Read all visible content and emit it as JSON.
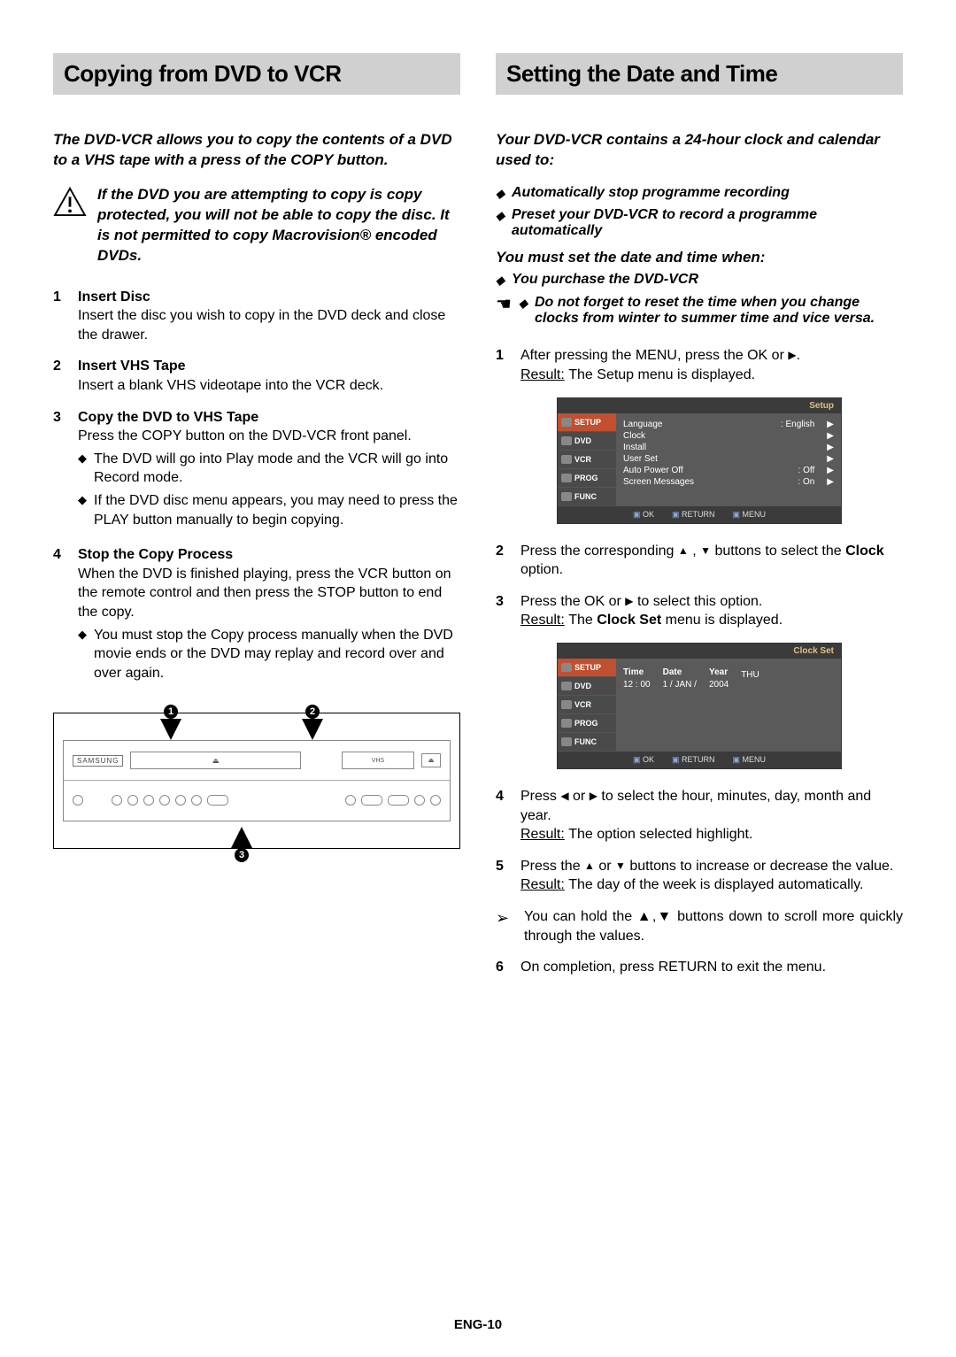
{
  "left": {
    "header": "Copying from DVD to VCR",
    "intro": "The DVD-VCR allows you to copy the contents of a DVD to a VHS tape with a press of the COPY button.",
    "warning": "If the DVD you are attempting to copy is copy protected, you will not be able to copy the disc. It is not permitted to copy Macrovision® encoded DVDs.",
    "steps": [
      {
        "num": "1",
        "title": "Insert Disc",
        "body": "Insert the disc you wish to copy in the DVD deck and close the drawer."
      },
      {
        "num": "2",
        "title": "Insert VHS Tape",
        "body": "Insert a blank VHS videotape into the VCR deck."
      },
      {
        "num": "3",
        "title": "Copy the DVD to VHS Tape",
        "body": "Press the COPY button on the DVD-VCR front panel.",
        "bullets": [
          "The DVD will go into Play mode and the VCR will go into Record mode.",
          "If the DVD disc menu appears, you may need to press the PLAY button manually to begin copying."
        ]
      },
      {
        "num": "4",
        "title": "Stop the Copy Process",
        "body": "When the DVD is finished playing, press the VCR button on the remote control and then press the STOP button to end the copy.",
        "bullets": [
          "You must stop the Copy process manually when the DVD movie ends or the DVD may replay and record over and over again."
        ]
      }
    ],
    "diagram": {
      "brand": "SAMSUNG",
      "vhs": "VHS",
      "markers": [
        "1",
        "2",
        "3"
      ]
    }
  },
  "right": {
    "header": "Setting the Date and Time",
    "intro": "Your DVD-VCR contains a 24-hour clock and calendar used to:",
    "intro_bullets": [
      "Automatically stop programme recording",
      "Preset your DVD-VCR to record a programme automatically"
    ],
    "must_set": "You must set the date and time when:",
    "must_set_bullets": [
      "You purchase the DVD-VCR"
    ],
    "pointer_note": "Do not forget to reset the time when you change clocks from winter to summer time and vice versa.",
    "steps": [
      {
        "num": "1",
        "body_pre": "After pressing the MENU, press the OK or ",
        "body_post": ".",
        "result": "The Setup menu is displayed."
      },
      {
        "num": "2",
        "body_pre": "Press the corresponding ",
        "body_mid": " , ",
        "body_post": " buttons to select the ",
        "bold": "Clock",
        "body_end": " option."
      },
      {
        "num": "3",
        "body_pre": "Press the OK or ",
        "body_post": " to select this option.",
        "result_pre": "The ",
        "result_bold": "Clock Set",
        "result_post": " menu is displayed."
      },
      {
        "num": "4",
        "body_pre": "Press ",
        "body_mid": " or ",
        "body_post": " to select the hour, minutes, day, month and year.",
        "result": "The option selected highlight."
      },
      {
        "num": "5",
        "body_pre": "Press the ",
        "body_mid": " or ",
        "body_post": " buttons to increase or decrease the value.",
        "result": "The day of the week is displayed automatically."
      },
      {
        "num": "6",
        "body": "On completion, press RETURN to exit the menu."
      }
    ],
    "tip": "You can hold the ▲,▼ buttons down to scroll more quickly through the values.",
    "osd_setup": {
      "title": "Setup",
      "tabs": [
        "SETUP",
        "DVD",
        "VCR",
        "PROG",
        "FUNC"
      ],
      "rows": [
        {
          "label": "Language",
          "val": ":  English"
        },
        {
          "label": "Clock",
          "val": ""
        },
        {
          "label": "Install",
          "val": ""
        },
        {
          "label": "User Set",
          "val": ""
        },
        {
          "label": "Auto Power Off",
          "val": ":  Off"
        },
        {
          "label": "Screen Messages",
          "val": ":  On"
        }
      ],
      "footer": [
        "OK",
        "RETURN",
        "MENU"
      ]
    },
    "osd_clock": {
      "title": "Clock Set",
      "tabs": [
        "SETUP",
        "DVD",
        "VCR",
        "PROG",
        "FUNC"
      ],
      "cols": [
        {
          "h": "Time",
          "v": "12 : 00"
        },
        {
          "h": "Date",
          "v": "1 / JAN /"
        },
        {
          "h": "Year",
          "v": "2004"
        },
        {
          "h": "",
          "v": "THU"
        }
      ],
      "footer": [
        "OK",
        "RETURN",
        "MENU"
      ]
    }
  },
  "footer": "ENG-10",
  "labels": {
    "result": "Result:"
  }
}
